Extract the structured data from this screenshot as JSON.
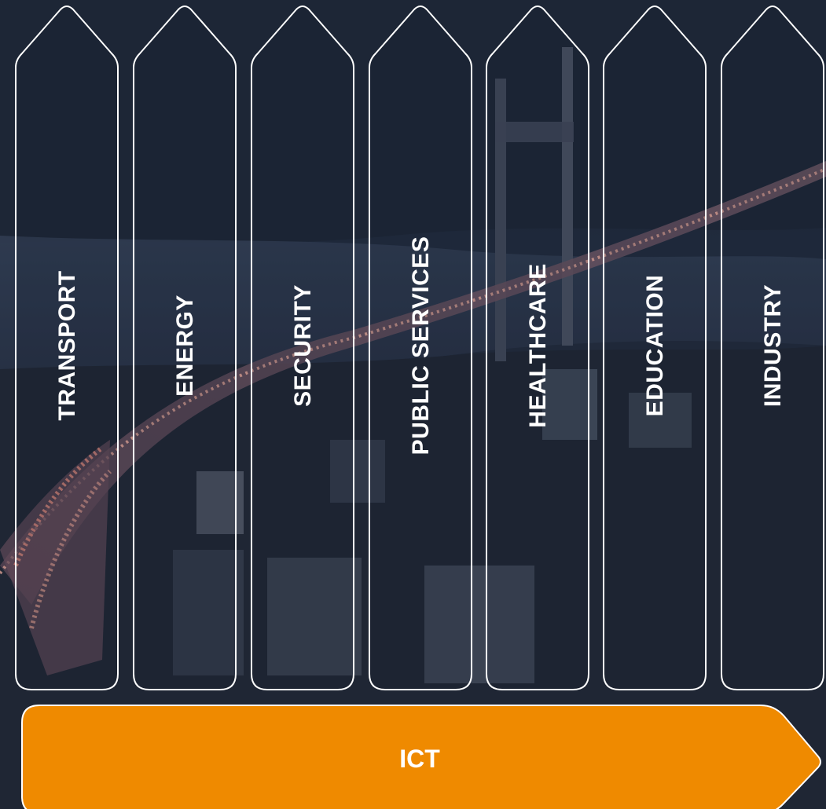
{
  "pillars": [
    {
      "label": "TRANSPORT"
    },
    {
      "label": "ENERGY"
    },
    {
      "label": "SECURITY"
    },
    {
      "label": "PUBLIC SERVICES"
    },
    {
      "label": "HEALTHCARE"
    },
    {
      "label": "EDUCATION"
    },
    {
      "label": "INDUSTRY"
    }
  ],
  "base": {
    "label": "ICT",
    "color": "#ef8a00"
  },
  "colors": {
    "outline": "#ffffff",
    "text": "#ffffff"
  }
}
